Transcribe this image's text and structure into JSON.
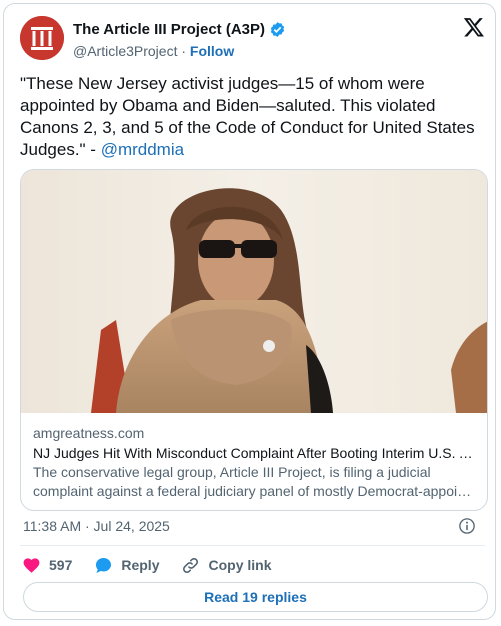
{
  "account": {
    "name": "The Article III Project (A3P)",
    "handle": "@Article3Project",
    "separator": "·",
    "follow_label": "Follow",
    "avatar_text": "III"
  },
  "tweet": {
    "text": "\"These New Jersey activist judges—15 of whom were appointed by Obama and Biden—saluted. This violated Canons 2, 3, and 5 of the Code of Conduct for United States Judges.\" - ",
    "mention": "@mrddmia"
  },
  "link_card": {
    "domain": "amgreatness.com",
    "title": "NJ Judges Hit With Misconduct Complaint After Booting Interim U.S. Att…",
    "description_line1": "The conservative legal group, Article III Project, is filing a judicial",
    "description_line2": "complaint against a federal judiciary panel of mostly Democrat-appoint…"
  },
  "timestamp": "11:38 AM · Jul 24, 2025",
  "actions": {
    "likes": "597",
    "reply_label": "Reply",
    "copy_label": "Copy link"
  },
  "read_replies_label": "Read 19 replies",
  "colors": {
    "accent": "#1d6fb8",
    "heart": "#f91880",
    "avatar_bg": "#c8372d",
    "verified": "#1d9bf0"
  },
  "icons": [
    "verified-badge-icon",
    "x-logo-icon",
    "info-icon",
    "heart-icon",
    "reply-bubble-icon",
    "link-icon"
  ]
}
